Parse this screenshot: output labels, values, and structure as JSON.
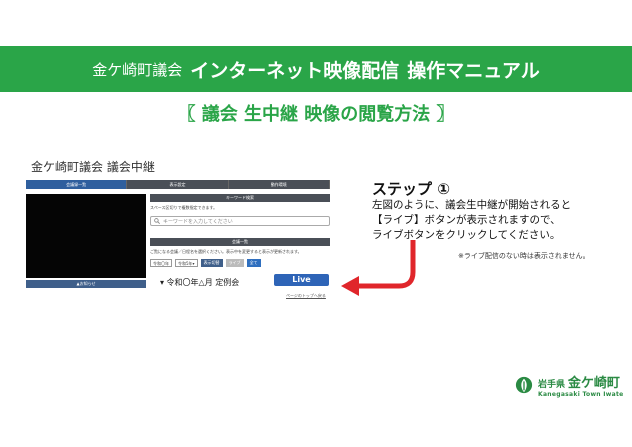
{
  "banner": {
    "prefix": "金ケ崎町議会",
    "title": "インターネット映像配信",
    "suffix": "操作マニュアル"
  },
  "subtitle": "〖 議会 生中継 映像の閲覧方法 〗",
  "screenshot": {
    "title": "金ケ崎町議会 議会中継",
    "nav": [
      "会議録一覧",
      "表示設定",
      "動作環境"
    ],
    "video_footer": "▲お知らせ",
    "keyword_panel": {
      "header": "キーワード検索",
      "hint": "スペース区切りで複数指定できます。",
      "placeholder": "キーワードを入力してください"
    },
    "list_panel": {
      "header": "会議一覧",
      "hint": "ご覧になる会議／日程名を選択ください。表示中を変更すると表示が更新されます。",
      "year": "令和〇年",
      "kind": "令和5年▾",
      "show_btn": "表示切替",
      "live_tab": "ライブ",
      "all_tab": "全て"
    },
    "meeting": "▾ 令和〇年△月 定例会",
    "live_button": "Live",
    "to_top": "ページのトップへ戻る"
  },
  "step": {
    "title": "ステップ ①",
    "lines": [
      "左図のように、議会生中継が開始されると",
      "【ライブ】ボタンが表示されますので、",
      "ライブボタンをクリックしてください。"
    ],
    "note": "※ライブ配信のない時は表示されません。"
  },
  "logo": {
    "pref": "岩手県",
    "town": "金ケ崎町",
    "romaji": "Kanegasaki Town Iwate"
  },
  "colors": {
    "green": "#2aa548",
    "arrow": "#e0262b",
    "live": "#2e64b7"
  }
}
